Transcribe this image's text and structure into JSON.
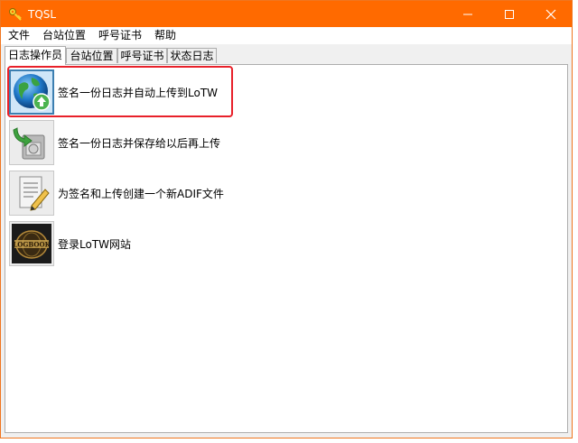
{
  "window": {
    "title": "TQSL",
    "controls": [
      "minimize-icon",
      "maximize-icon",
      "close-icon"
    ]
  },
  "menu": {
    "items": [
      "文件",
      "台站位置",
      "呼号证书",
      "帮助"
    ]
  },
  "tabs": [
    {
      "label": "日志操作员",
      "active": true
    },
    {
      "label": "台站位置",
      "active": false
    },
    {
      "label": "呼号证书",
      "active": false
    },
    {
      "label": "状态日志",
      "active": false
    }
  ],
  "actions": [
    {
      "label": "签名一份日志并自动上传到LoTW",
      "icon": "globe-upload-icon",
      "highlighted": true
    },
    {
      "label": "签名一份日志并保存给以后再上传",
      "icon": "save-log-icon",
      "highlighted": false
    },
    {
      "label": "为签名和上传创建一个新ADIF文件",
      "icon": "edit-document-icon",
      "highlighted": false
    },
    {
      "label": "登录LoTW网站",
      "icon": "logbook-world-icon",
      "highlighted": false
    }
  ],
  "colors": {
    "titlebar": "#ff6a00",
    "highlight": "#e8212a",
    "selected_button": "#cfe6f8"
  }
}
